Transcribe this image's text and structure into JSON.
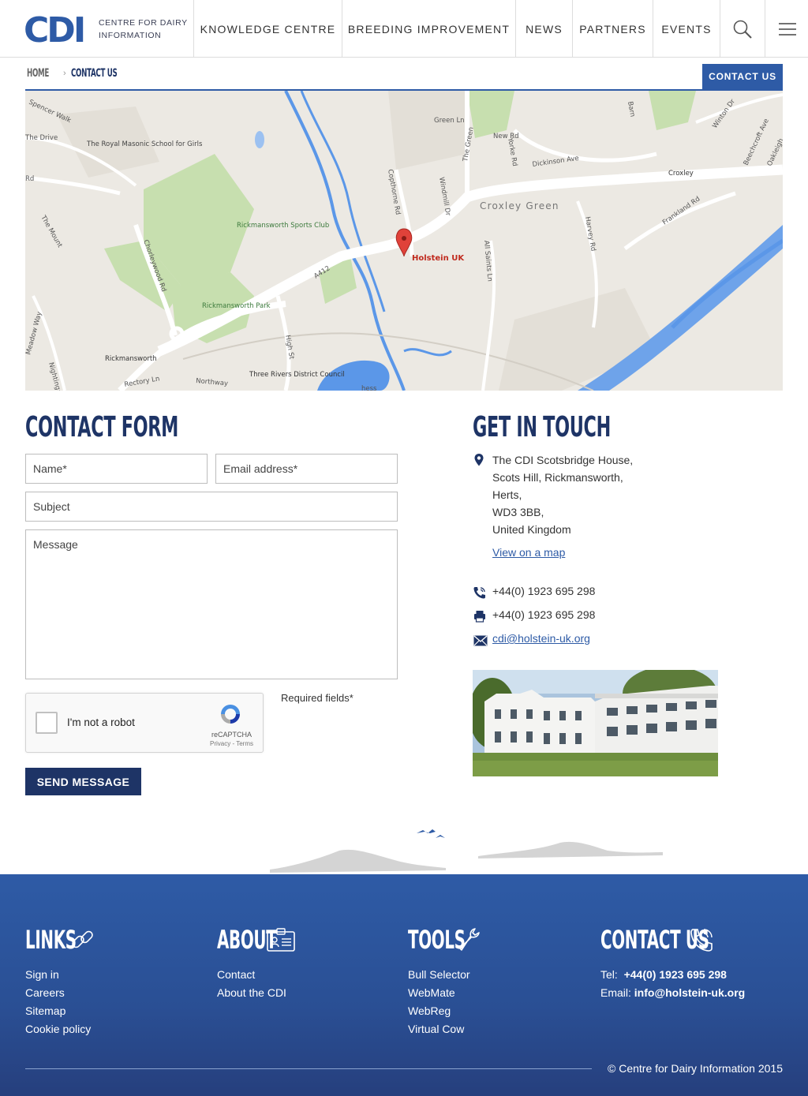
{
  "header": {
    "logo_letters": "CDI",
    "logo_line1": "CENTRE FOR DAIRY",
    "logo_line2": "INFORMATION",
    "nav": [
      "KNOWLEDGE CENTRE",
      "BREEDING IMPROVEMENT",
      "NEWS",
      "PARTNERS",
      "EVENTS"
    ]
  },
  "breadcrumb": {
    "home": "HOME",
    "current": "CONTACT US",
    "button": "CONTACT US"
  },
  "map": {
    "pin_label": "Holstein UK",
    "labels": [
      "Croxley Green",
      "Rickmansworth Sports Club",
      "Rickmansworth Park",
      "Rickmansworth",
      "The Royal Masonic School for Girls",
      "Three Rivers District Council",
      "Croxley",
      "A412",
      "Chorleywood Rd",
      "Copthorne Rd",
      "Windmill Dr",
      "New Rd",
      "Dickinson Ave",
      "Green Ln",
      "Yorke Rd",
      "All Saints Ln",
      "Harvey Rd",
      "Frankland Rd",
      "Spencer Walk",
      "The Drive",
      "The Mount",
      "Meadow Way",
      "Rectory Ln",
      "Northway",
      "High St",
      "The Green",
      "Winton Dr",
      "Beechcroft Ave",
      "Oakleigh",
      "Barn",
      "Nightingale",
      "Rd",
      "hess"
    ]
  },
  "form": {
    "title": "CONTACT FORM",
    "name_placeholder": "Name*",
    "email_placeholder": "Email address*",
    "subject_placeholder": "Subject",
    "message_placeholder": "Message",
    "captcha_label": "I'm not a robot",
    "captcha_brand": "reCAPTCHA",
    "captcha_terms": "Privacy - Terms",
    "required_note": "Required fields*",
    "send_button": "SEND MESSAGE"
  },
  "touch": {
    "title": "GET IN TOUCH",
    "address": [
      "The CDI Scotsbridge House,",
      "Scots Hill, Rickmansworth,",
      "Herts,",
      "WD3 3BB,",
      "United Kingdom"
    ],
    "map_link": "View on a map",
    "phone": "+44(0) 1923 695 298",
    "fax": "+44(0) 1923 695 298",
    "email": "cdi@holstein-uk.org"
  },
  "footer": {
    "links_title": "LINKS",
    "links": [
      "Sign in",
      "Careers",
      "Sitemap",
      "Cookie policy"
    ],
    "about_title": "ABOUT",
    "about": [
      "Contact",
      "About the CDI"
    ],
    "tools_title": "TOOLS",
    "tools": [
      "Bull Selector",
      "WebMate",
      "WebReg",
      "Virtual Cow"
    ],
    "contact_title": "CONTACT US",
    "tel_label": "Tel:",
    "tel": "+44(0) 1923 695 298",
    "email_label": "Email:",
    "email": "info@holstein-uk.org",
    "copyright": "© Centre for Dairy Information 2015"
  },
  "colors": {
    "brand_blue": "#2e5ba6",
    "navy": "#1e3466",
    "map_bg": "#ece9e3",
    "park_green": "#c7dfaf",
    "water_blue": "#5b97e8"
  }
}
